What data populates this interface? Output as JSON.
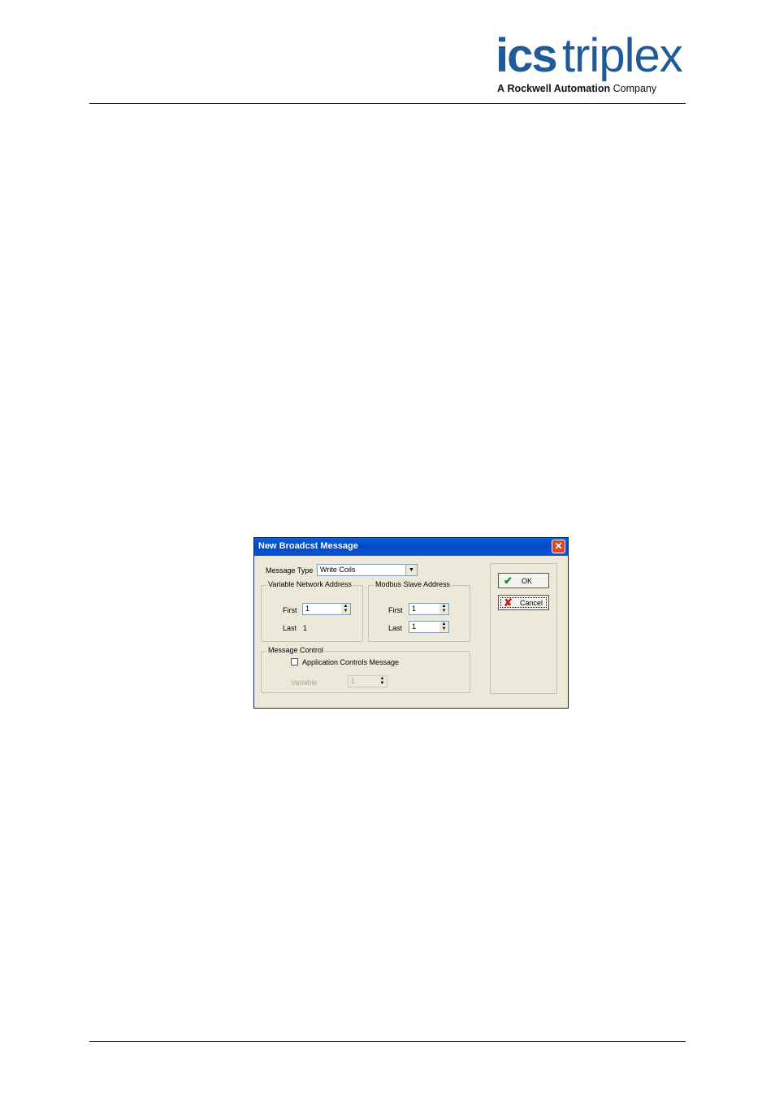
{
  "header": {
    "logo_ics": "ics",
    "logo_triplex": "triplex",
    "logo_tagline_a": "A",
    "logo_tagline_brand": "Rockwell Automation",
    "logo_tagline_company": "Company",
    "logo_color": "#1f5b9b"
  },
  "dialog": {
    "title": "New Broadcst Message",
    "message_type_label": "Message Type",
    "message_type_value": "Write Coils",
    "vna_group": "Variable Network Address",
    "vna_first_label": "First",
    "vna_first_value": "1",
    "vna_last_label": "Last",
    "vna_last_value": "1",
    "msa_group": "Modbus Slave Address",
    "msa_first_label": "First",
    "msa_first_value": "1",
    "msa_last_label": "Last",
    "msa_last_value": "1",
    "mc_group": "Message Control",
    "app_controls_label": "Application Controls Message",
    "app_controls_checked": false,
    "variable_label": "Variable",
    "variable_value": "1",
    "ok_label": "OK",
    "cancel_label": "Cancel"
  }
}
